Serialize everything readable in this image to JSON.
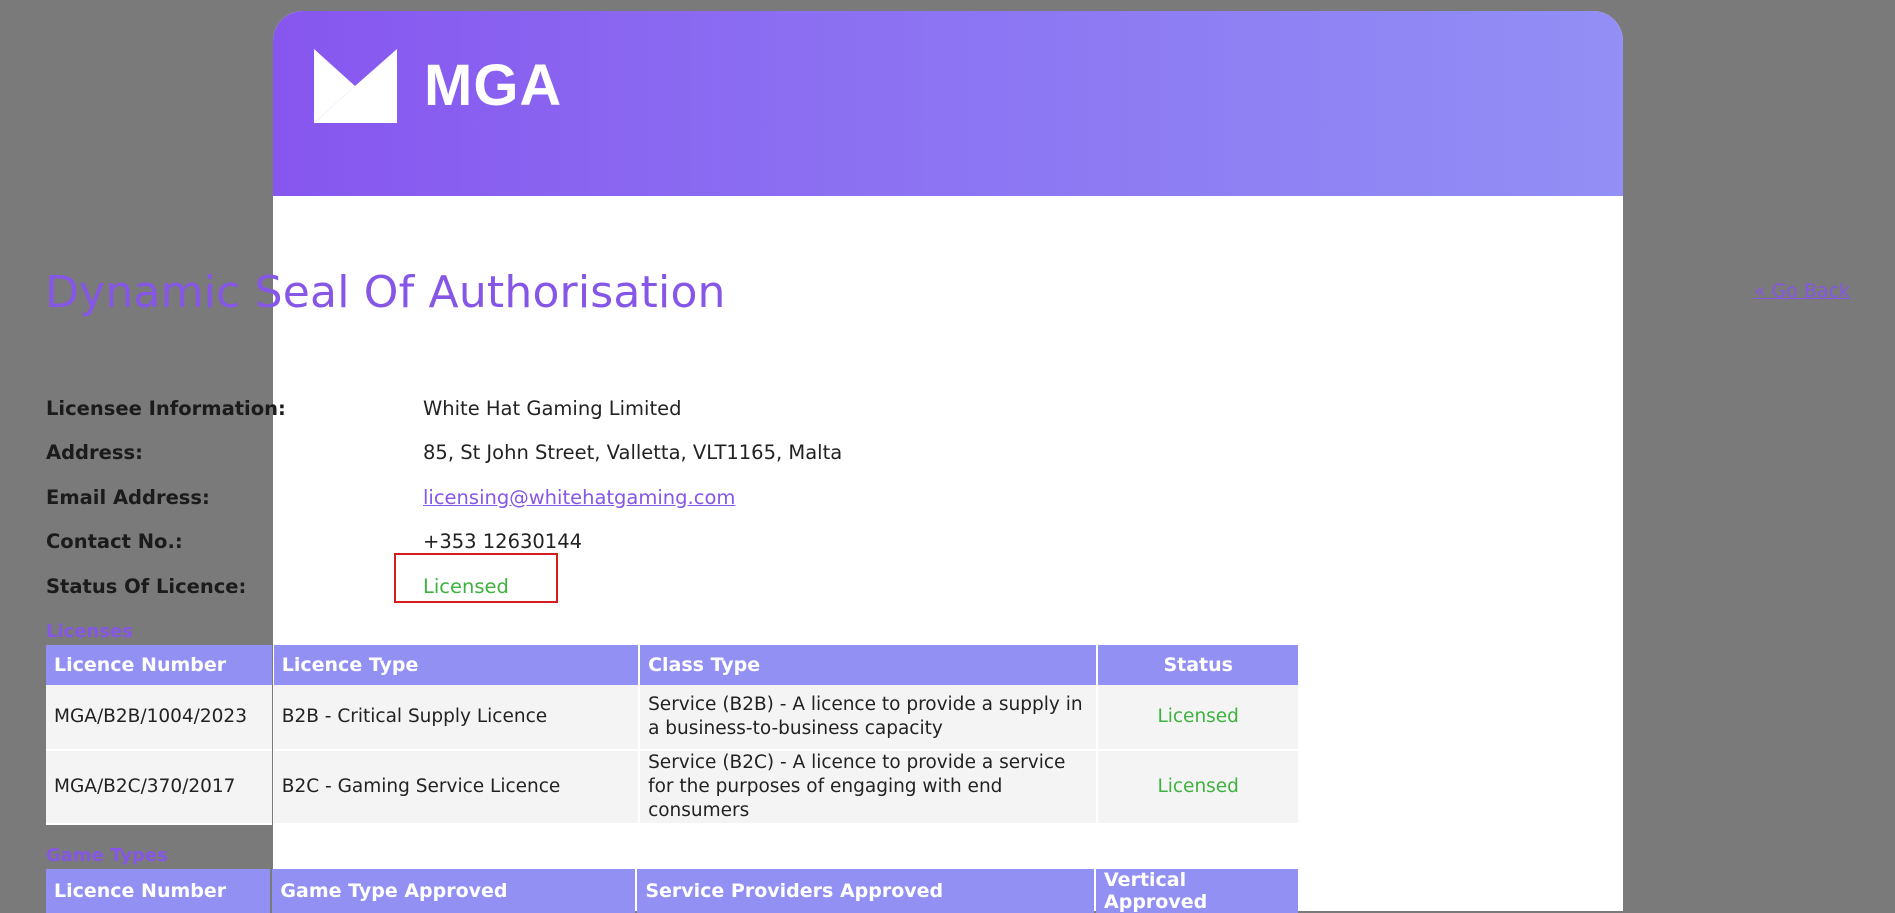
{
  "brand": {
    "logo_text": "MGA"
  },
  "page": {
    "title": "Dynamic Seal Of Authorisation",
    "go_back": "« Go Back"
  },
  "licensee": [
    {
      "label": "Licensee Information:",
      "value": "White Hat Gaming Limited"
    },
    {
      "label": "Address:",
      "value": "85, St John Street, Valletta, VLT1165, Malta"
    },
    {
      "label": "Email Address:",
      "value": "licensing@whitehatgaming.com"
    },
    {
      "label": "Contact No.:",
      "value": "+353 12630144"
    },
    {
      "label": "Status Of Licence:",
      "value": "Licensed"
    }
  ],
  "licenses": {
    "title": "Licenses",
    "headers": [
      "Licence Number",
      "Licence Type",
      "Class Type",
      "Status"
    ],
    "rows": [
      [
        "MGA/B2B/1004/2023",
        "B2B - Critical Supply Licence",
        "Service (B2B) - A licence to provide a supply in a business-to-business capacity",
        "Licensed"
      ],
      [
        "MGA/B2C/370/2017",
        "B2C - Gaming Service Licence",
        "Service (B2C) - A licence to provide a service for the purposes of engaging with end consumers",
        "Licensed"
      ]
    ]
  },
  "game_types": {
    "title": "Game Types",
    "headers": [
      "Licence Number",
      "Game Type Approved",
      "Service Providers Approved",
      "Vertical Approved"
    ]
  },
  "colors": {
    "accent": "#8656e6",
    "header_bg": "#9390f3",
    "licensed": "#3eb23e",
    "highlight": "#d61d1d"
  }
}
